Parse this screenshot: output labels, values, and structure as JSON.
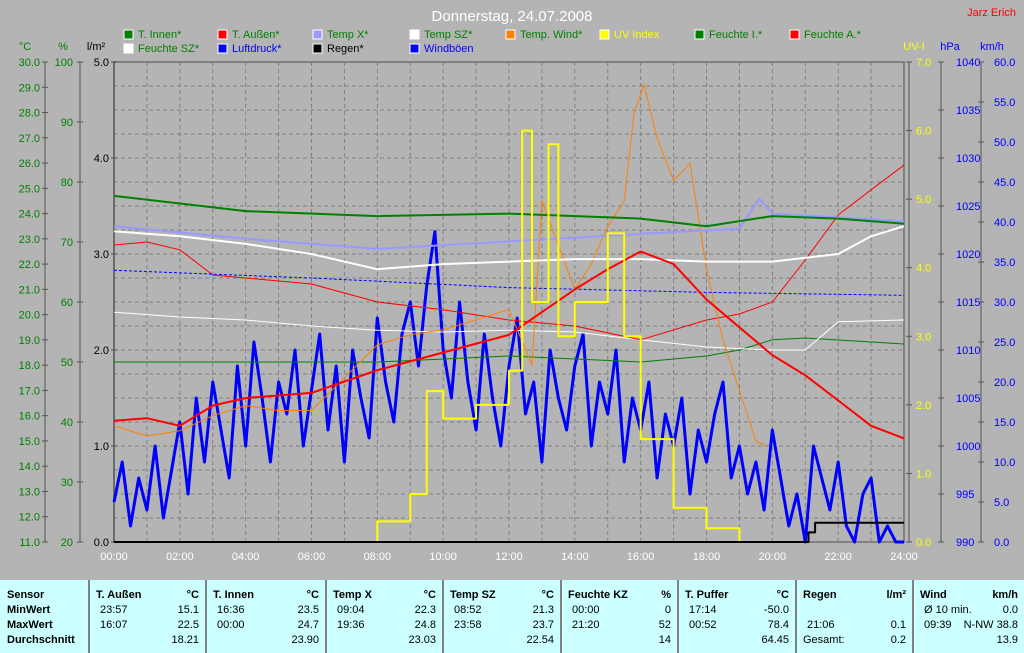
{
  "title": "Donnerstag, 24.07.2008",
  "author": "Jarz Erich",
  "colors": {
    "t_innen": "#008000",
    "t_aussen": "#ff0000",
    "temp_x": "#9999ff",
    "temp_sz": "#ffffff",
    "temp_wind": "#ff8000",
    "uv": "#ffff00",
    "feuchte_i": "#008000",
    "feuchte_a": "#ff0000",
    "feuchte_sz": "#ffffff",
    "luftdruck": "#0000ff",
    "regen": "#000000",
    "windboeen": "#0000ff"
  },
  "chart_data": {
    "type": "line",
    "title": "Donnerstag, 24.07.2008",
    "xlabel": "",
    "x_ticks": [
      "00:00",
      "02:00",
      "04:00",
      "06:00",
      "08:00",
      "10:00",
      "12:00",
      "14:00",
      "16:00",
      "18:00",
      "20:00",
      "22:00",
      "24:00"
    ],
    "xlim": [
      0,
      24
    ],
    "axes": [
      {
        "id": "c",
        "unit": "°C",
        "range": [
          11,
          30
        ],
        "step": 1,
        "dec": 1,
        "color": "#008000"
      },
      {
        "id": "p",
        "unit": "%",
        "range": [
          20,
          100
        ],
        "step": 10,
        "dec": 0,
        "color": "#008000"
      },
      {
        "id": "r",
        "unit": "l/m²",
        "range": [
          0,
          5
        ],
        "step": 1,
        "dec": 1,
        "color": "#000000"
      },
      {
        "id": "u",
        "unit": "UV-I",
        "range": [
          0,
          7
        ],
        "step": 1,
        "dec": 1,
        "color": "#ffff00"
      },
      {
        "id": "h",
        "unit": "hPa",
        "range": [
          990,
          1040
        ],
        "step": 5,
        "dec": 0,
        "color": "#0000ff"
      },
      {
        "id": "k",
        "unit": "km/h",
        "range": [
          0,
          60
        ],
        "step": 5,
        "dec": 1,
        "color": "#0000ff"
      }
    ],
    "legend": [
      {
        "label": "T. Innen*",
        "color": "#008000",
        "text": "#008000"
      },
      {
        "label": "T. Außen*",
        "color": "#ff0000",
        "text": "#008000"
      },
      {
        "label": "Temp X*",
        "color": "#9999ff",
        "text": "#008000"
      },
      {
        "label": "Temp SZ*",
        "color": "#ffffff",
        "text": "#008000"
      },
      {
        "label": "Temp. Wind*",
        "color": "#ff8000",
        "text": "#008000"
      },
      {
        "label": "UV Index",
        "color": "#ffff00",
        "text": "#ffff00"
      },
      {
        "label": "Feuchte I.*",
        "color": "#008000",
        "text": "#008000"
      },
      {
        "label": "Feuchte A.*",
        "color": "#ff0000",
        "text": "#008000"
      },
      {
        "label": "Feuchte SZ*",
        "color": "#ffffff",
        "text": "#008000"
      },
      {
        "label": "Luftdruck*",
        "color": "#0000ff",
        "text": "#0000ff"
      },
      {
        "label": "Regen*",
        "color": "#000000",
        "text": "#000000"
      },
      {
        "label": "Windböen",
        "color": "#0000ff",
        "text": "#0000ff"
      }
    ],
    "series": [
      {
        "name": "Windböen",
        "axis": "k",
        "color": "#0000ff",
        "width": 3,
        "x0": 0,
        "dx": 0.25,
        "y": [
          5,
          10,
          2,
          8,
          4,
          12,
          3,
          9,
          15,
          6,
          18,
          10,
          20,
          14,
          8,
          22,
          12,
          25,
          18,
          10,
          20,
          16,
          24,
          12,
          19,
          26,
          14,
          22,
          10,
          24,
          18,
          13,
          28,
          20,
          15,
          26,
          30,
          22,
          32,
          38.8,
          24,
          18,
          30,
          20,
          14,
          26,
          18,
          12,
          22,
          28,
          16,
          20,
          10,
          24,
          18,
          14,
          22,
          26,
          12,
          20,
          16,
          24,
          10,
          18,
          14,
          20,
          8,
          16,
          12,
          18,
          6,
          14,
          10,
          16,
          20,
          8,
          12,
          6,
          10,
          4,
          14,
          8,
          2,
          6,
          0,
          12,
          8,
          4,
          10,
          2,
          0,
          6,
          8,
          0,
          2,
          0,
          0
        ]
      },
      {
        "name": "Feuchte I.",
        "axis": "p",
        "color": "#008000",
        "width": 1,
        "x": [
          0,
          8,
          12,
          16,
          18,
          19,
          20,
          21,
          24
        ],
        "y": [
          50,
          50,
          51,
          50,
          51,
          52,
          53.7,
          54,
          53
        ]
      },
      {
        "name": "Feuchte SZ",
        "axis": "p",
        "color": "#ffffff",
        "width": 1,
        "x": [
          0,
          2,
          4,
          6,
          8,
          10,
          12,
          14,
          16,
          18,
          20,
          21,
          22,
          24
        ],
        "y": [
          58.3,
          57.5,
          57,
          56,
          55.3,
          55,
          55.3,
          55,
          53.7,
          52.5,
          52,
          52,
          56.7,
          57
        ]
      },
      {
        "name": "Feuchte A.",
        "axis": "p",
        "color": "#ff0000",
        "width": 1,
        "x": [
          0,
          1,
          2,
          3,
          4,
          6,
          8,
          10,
          12,
          14,
          16,
          18,
          19,
          20,
          21,
          22,
          23,
          24
        ],
        "y": [
          69.5,
          70,
          68.7,
          64.5,
          64,
          63,
          60,
          58.7,
          57,
          56,
          53.7,
          57,
          58,
          60,
          67,
          74.5,
          78.7,
          82.8
        ]
      },
      {
        "name": "Luftdruck",
        "axis": "h",
        "color": "#0000ff",
        "width": 1,
        "dash": "3,2",
        "x": [
          0,
          6,
          12,
          18,
          24
        ],
        "y": [
          1018.3,
          1017.5,
          1016.5,
          1016,
          1015.7
        ]
      },
      {
        "name": "Temp. Wind",
        "axis": "c",
        "color": "#ff8000",
        "width": 1,
        "x": [
          0,
          1,
          2,
          3,
          4,
          5,
          6,
          7,
          8,
          9,
          10,
          11,
          12,
          12.7,
          13,
          14,
          14.5,
          15,
          15.5,
          15.8,
          16.1,
          16.5,
          17,
          17.5,
          18,
          18.5,
          19,
          19.5,
          19.8
        ],
        "y": [
          15.6,
          15.2,
          15.4,
          16,
          16.4,
          16.2,
          16.2,
          17.5,
          18.8,
          19.2,
          19.4,
          19.8,
          20.2,
          18,
          24.5,
          21,
          22,
          23.5,
          24.5,
          28,
          29.1,
          27,
          25.3,
          26,
          21.8,
          19,
          17,
          15,
          14.8
        ]
      },
      {
        "name": "Temp X",
        "axis": "c",
        "color": "#9999ff",
        "width": 2,
        "x": [
          0,
          4,
          8,
          12,
          16,
          19,
          19.6,
          20,
          24
        ],
        "y": [
          23.5,
          23,
          22.6,
          22.9,
          23.2,
          23.4,
          24.6,
          24,
          23.7
        ]
      },
      {
        "name": "Temp SZ",
        "axis": "c",
        "color": "#ffffff",
        "width": 2,
        "x": [
          0,
          2,
          4,
          6,
          8,
          10,
          12,
          14,
          16,
          18,
          20,
          22,
          23,
          24
        ],
        "y": [
          23.3,
          23.1,
          22.8,
          22.4,
          21.8,
          22,
          22.1,
          22.2,
          22.2,
          22.1,
          22.1,
          22.4,
          23.1,
          23.5
        ]
      },
      {
        "name": "T. Innen",
        "axis": "c",
        "color": "#008000",
        "width": 2,
        "x": [
          0,
          4,
          8,
          12,
          16,
          18,
          20,
          22,
          24
        ],
        "y": [
          24.7,
          24.1,
          23.9,
          24,
          23.8,
          23.5,
          23.9,
          23.8,
          23.6
        ]
      },
      {
        "name": "T. Außen",
        "axis": "c",
        "color": "#ff0000",
        "width": 2,
        "x": [
          0,
          1,
          2,
          3,
          4,
          6,
          8,
          10,
          12,
          14,
          15,
          16,
          17,
          18,
          19,
          20,
          21,
          22,
          23,
          24
        ],
        "y": [
          15.8,
          15.9,
          15.6,
          16.4,
          16.7,
          16.9,
          17.8,
          18.5,
          19.2,
          21,
          21.8,
          22.5,
          22,
          20.6,
          19.5,
          18.4,
          17.6,
          16.6,
          15.6,
          15.1
        ]
      },
      {
        "name": "UV Index",
        "axis": "u",
        "color": "#ffff00",
        "width": 2,
        "step": true,
        "x": [
          7.3,
          8,
          9,
          9.5,
          10,
          11,
          12,
          12.4,
          12.7,
          13.2,
          13.5,
          14,
          15,
          15.5,
          16,
          17,
          18,
          19
        ],
        "y": [
          0,
          0.3,
          0.7,
          2.2,
          1.8,
          2,
          2.5,
          6,
          3.5,
          5.8,
          3,
          3.5,
          4.5,
          3,
          1.5,
          0.5,
          0.2,
          0
        ]
      },
      {
        "name": "Regen",
        "axis": "r",
        "color": "#000000",
        "width": 2,
        "step": true,
        "x": [
          0,
          21,
          21.1,
          21.3,
          24
        ],
        "y": [
          0,
          0,
          0.1,
          0.2,
          0.2
        ]
      }
    ]
  },
  "table": {
    "row_labels": [
      "Sensor",
      "MinWert",
      "MaxWert",
      "Durchschnitt"
    ],
    "columns": [
      {
        "name": "T. Außen",
        "unit": "°C",
        "min_time": "23:57",
        "min": "15.1",
        "max_time": "16:07",
        "max": "22.5",
        "avg_label": "",
        "avg": "18.21"
      },
      {
        "name": "T. Innen",
        "unit": "°C",
        "min_time": "16:36",
        "min": "23.5",
        "max_time": "00:00",
        "max": "24.7",
        "avg_label": "",
        "avg": "23.90"
      },
      {
        "name": "Temp X",
        "unit": "°C",
        "min_time": "09:04",
        "min": "22.3",
        "max_time": "19:36",
        "max": "24.8",
        "avg_label": "",
        "avg": "23.03"
      },
      {
        "name": "Temp SZ",
        "unit": "°C",
        "min_time": "08:52",
        "min": "21.3",
        "max_time": "23:58",
        "max": "23.7",
        "avg_label": "",
        "avg": "22.54"
      },
      {
        "name": "Feuchte KZ",
        "unit": "%",
        "min_time": "00:00",
        "min": "0",
        "max_time": "21:20",
        "max": "52",
        "avg_label": "",
        "avg": "14"
      },
      {
        "name": "T. Puffer",
        "unit": "°C",
        "min_time": "17:14",
        "min": "-50.0",
        "max_time": "00:52",
        "max": "78.4",
        "avg_label": "",
        "avg": "64.45"
      },
      {
        "name": "Regen",
        "unit": "l/m²",
        "min_time": "",
        "min": "",
        "max_time": "21:06",
        "max": "0.1",
        "avg_label": "Gesamt:",
        "avg": "0.2"
      },
      {
        "name": "Wind",
        "unit": "km/h",
        "min_time": "Ø 10 min.",
        "min": "0.0",
        "max_time": "09:39",
        "max": "N-NW 38.8",
        "avg_label": "",
        "avg": "13.9"
      }
    ]
  }
}
